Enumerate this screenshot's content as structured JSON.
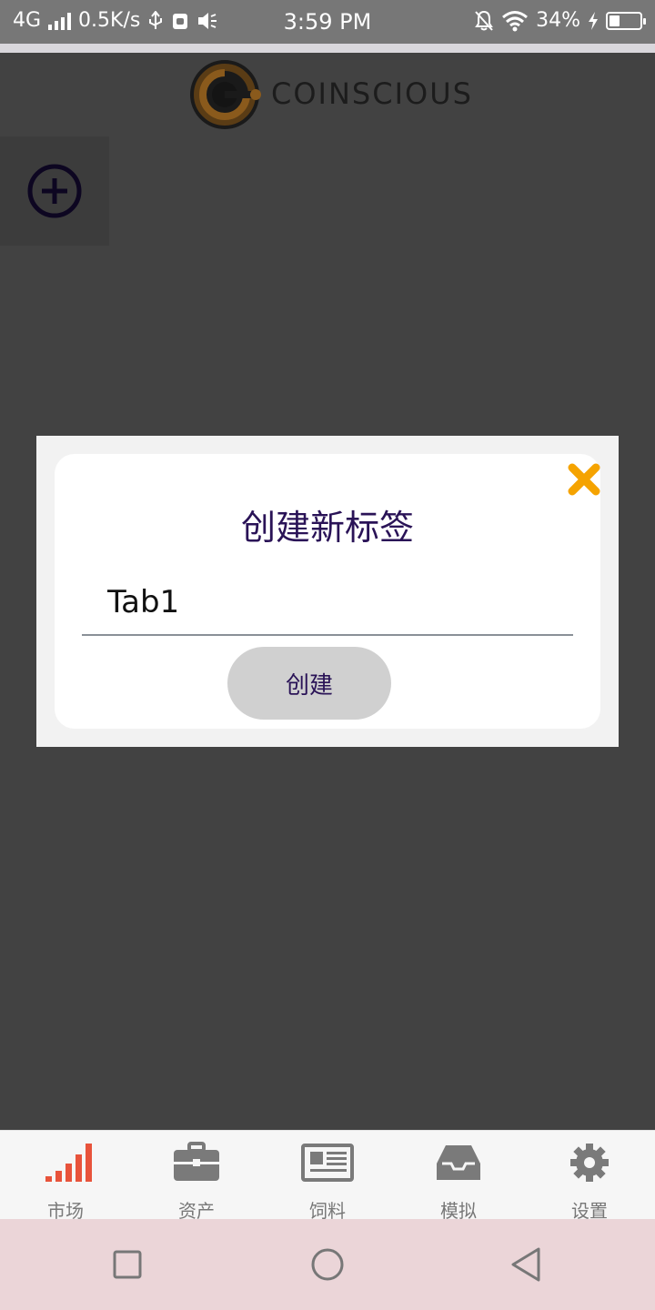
{
  "status_bar": {
    "network": "4G",
    "speed": "0.5K/s",
    "time": "3:59 PM",
    "battery_percent": "34%",
    "battery_level": 0.34
  },
  "header": {
    "brand": "COINSCIOUS",
    "logo_icon": "coinscious-logo-icon",
    "add_tab_icon": "add-circle-icon"
  },
  "dialog": {
    "title": "创建新标签",
    "input_value": "Tab1",
    "create_label": "创建",
    "close_icon": "close-x-icon",
    "accent_color": "#f5a300"
  },
  "tabbar": {
    "items": [
      {
        "label": "市场",
        "icon": "signal-bars-icon",
        "active": true
      },
      {
        "label": "资产",
        "icon": "briefcase-icon",
        "active": false
      },
      {
        "label": "饲料",
        "icon": "newspaper-icon",
        "active": false
      },
      {
        "label": "模拟",
        "icon": "inbox-tray-icon",
        "active": false
      },
      {
        "label": "设置",
        "icon": "gear-icon",
        "active": false
      }
    ],
    "active_color": "#e8533b",
    "inactive_color": "#7a7a7a"
  },
  "system_nav": {
    "recent_icon": "square-icon",
    "home_icon": "circle-icon",
    "back_icon": "triangle-back-icon"
  }
}
